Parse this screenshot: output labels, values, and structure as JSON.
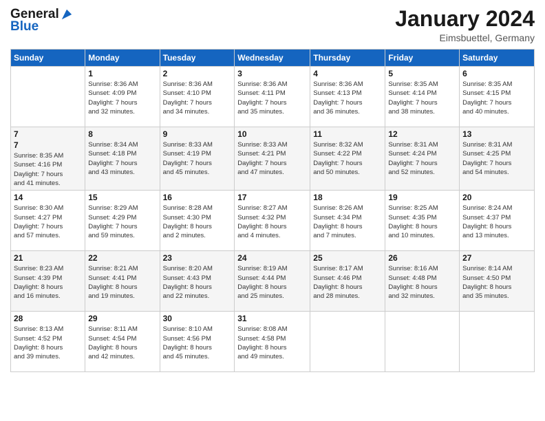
{
  "header": {
    "logo_line1": "General",
    "logo_line2": "Blue",
    "month_title": "January 2024",
    "location": "Eimsbuettel, Germany"
  },
  "calendar": {
    "days_of_week": [
      "Sunday",
      "Monday",
      "Tuesday",
      "Wednesday",
      "Thursday",
      "Friday",
      "Saturday"
    ],
    "weeks": [
      [
        {
          "day": "",
          "info": ""
        },
        {
          "day": "1",
          "info": "Sunrise: 8:36 AM\nSunset: 4:09 PM\nDaylight: 7 hours\nand 32 minutes."
        },
        {
          "day": "2",
          "info": "Sunrise: 8:36 AM\nSunset: 4:10 PM\nDaylight: 7 hours\nand 34 minutes."
        },
        {
          "day": "3",
          "info": "Sunrise: 8:36 AM\nSunset: 4:11 PM\nDaylight: 7 hours\nand 35 minutes."
        },
        {
          "day": "4",
          "info": "Sunrise: 8:36 AM\nSunset: 4:13 PM\nDaylight: 7 hours\nand 36 minutes."
        },
        {
          "day": "5",
          "info": "Sunrise: 8:35 AM\nSunset: 4:14 PM\nDaylight: 7 hours\nand 38 minutes."
        },
        {
          "day": "6",
          "info": "Sunrise: 8:35 AM\nSunset: 4:15 PM\nDaylight: 7 hours\nand 40 minutes."
        }
      ],
      [
        {
          "day": "7",
          "info": ""
        },
        {
          "day": "8",
          "info": "Sunrise: 8:34 AM\nSunset: 4:18 PM\nDaylight: 7 hours\nand 43 minutes."
        },
        {
          "day": "9",
          "info": "Sunrise: 8:33 AM\nSunset: 4:19 PM\nDaylight: 7 hours\nand 45 minutes."
        },
        {
          "day": "10",
          "info": "Sunrise: 8:33 AM\nSunset: 4:21 PM\nDaylight: 7 hours\nand 47 minutes."
        },
        {
          "day": "11",
          "info": "Sunrise: 8:32 AM\nSunset: 4:22 PM\nDaylight: 7 hours\nand 50 minutes."
        },
        {
          "day": "12",
          "info": "Sunrise: 8:31 AM\nSunset: 4:24 PM\nDaylight: 7 hours\nand 52 minutes."
        },
        {
          "day": "13",
          "info": "Sunrise: 8:31 AM\nSunset: 4:25 PM\nDaylight: 7 hours\nand 54 minutes."
        }
      ],
      [
        {
          "day": "14",
          "info": "Sunrise: 8:30 AM\nSunset: 4:27 PM\nDaylight: 7 hours\nand 57 minutes."
        },
        {
          "day": "15",
          "info": "Sunrise: 8:29 AM\nSunset: 4:29 PM\nDaylight: 7 hours\nand 59 minutes."
        },
        {
          "day": "16",
          "info": "Sunrise: 8:28 AM\nSunset: 4:30 PM\nDaylight: 8 hours\nand 2 minutes."
        },
        {
          "day": "17",
          "info": "Sunrise: 8:27 AM\nSunset: 4:32 PM\nDaylight: 8 hours\nand 4 minutes."
        },
        {
          "day": "18",
          "info": "Sunrise: 8:26 AM\nSunset: 4:34 PM\nDaylight: 8 hours\nand 7 minutes."
        },
        {
          "day": "19",
          "info": "Sunrise: 8:25 AM\nSunset: 4:35 PM\nDaylight: 8 hours\nand 10 minutes."
        },
        {
          "day": "20",
          "info": "Sunrise: 8:24 AM\nSunset: 4:37 PM\nDaylight: 8 hours\nand 13 minutes."
        }
      ],
      [
        {
          "day": "21",
          "info": "Sunrise: 8:23 AM\nSunset: 4:39 PM\nDaylight: 8 hours\nand 16 minutes."
        },
        {
          "day": "22",
          "info": "Sunrise: 8:21 AM\nSunset: 4:41 PM\nDaylight: 8 hours\nand 19 minutes."
        },
        {
          "day": "23",
          "info": "Sunrise: 8:20 AM\nSunset: 4:43 PM\nDaylight: 8 hours\nand 22 minutes."
        },
        {
          "day": "24",
          "info": "Sunrise: 8:19 AM\nSunset: 4:44 PM\nDaylight: 8 hours\nand 25 minutes."
        },
        {
          "day": "25",
          "info": "Sunrise: 8:17 AM\nSunset: 4:46 PM\nDaylight: 8 hours\nand 28 minutes."
        },
        {
          "day": "26",
          "info": "Sunrise: 8:16 AM\nSunset: 4:48 PM\nDaylight: 8 hours\nand 32 minutes."
        },
        {
          "day": "27",
          "info": "Sunrise: 8:14 AM\nSunset: 4:50 PM\nDaylight: 8 hours\nand 35 minutes."
        }
      ],
      [
        {
          "day": "28",
          "info": "Sunrise: 8:13 AM\nSunset: 4:52 PM\nDaylight: 8 hours\nand 39 minutes."
        },
        {
          "day": "29",
          "info": "Sunrise: 8:11 AM\nSunset: 4:54 PM\nDaylight: 8 hours\nand 42 minutes."
        },
        {
          "day": "30",
          "info": "Sunrise: 8:10 AM\nSunset: 4:56 PM\nDaylight: 8 hours\nand 45 minutes."
        },
        {
          "day": "31",
          "info": "Sunrise: 8:08 AM\nSunset: 4:58 PM\nDaylight: 8 hours\nand 49 minutes."
        },
        {
          "day": "",
          "info": ""
        },
        {
          "day": "",
          "info": ""
        },
        {
          "day": "",
          "info": ""
        }
      ]
    ]
  }
}
